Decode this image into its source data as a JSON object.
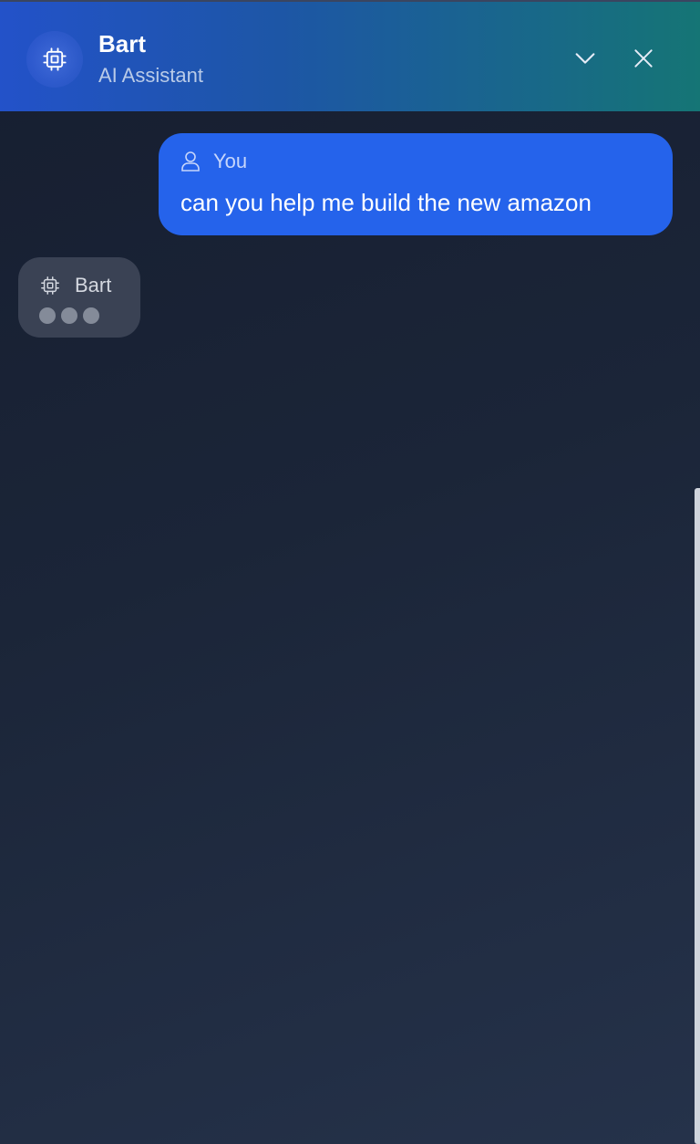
{
  "header": {
    "title": "Bart",
    "subtitle": "AI Assistant",
    "avatar_icon": "chip-icon",
    "minimize_icon": "chevron-down-icon",
    "close_icon": "close-icon"
  },
  "messages": [
    {
      "sender": "You",
      "icon": "user-icon",
      "text": "can you help me build the new amazon"
    },
    {
      "sender": "Bart",
      "icon": "chip-icon",
      "status": "typing"
    }
  ],
  "colors": {
    "user_bubble": "#2563eb",
    "bot_bubble": "#3a4254",
    "header_start": "#2352c9",
    "header_end": "#157575"
  }
}
